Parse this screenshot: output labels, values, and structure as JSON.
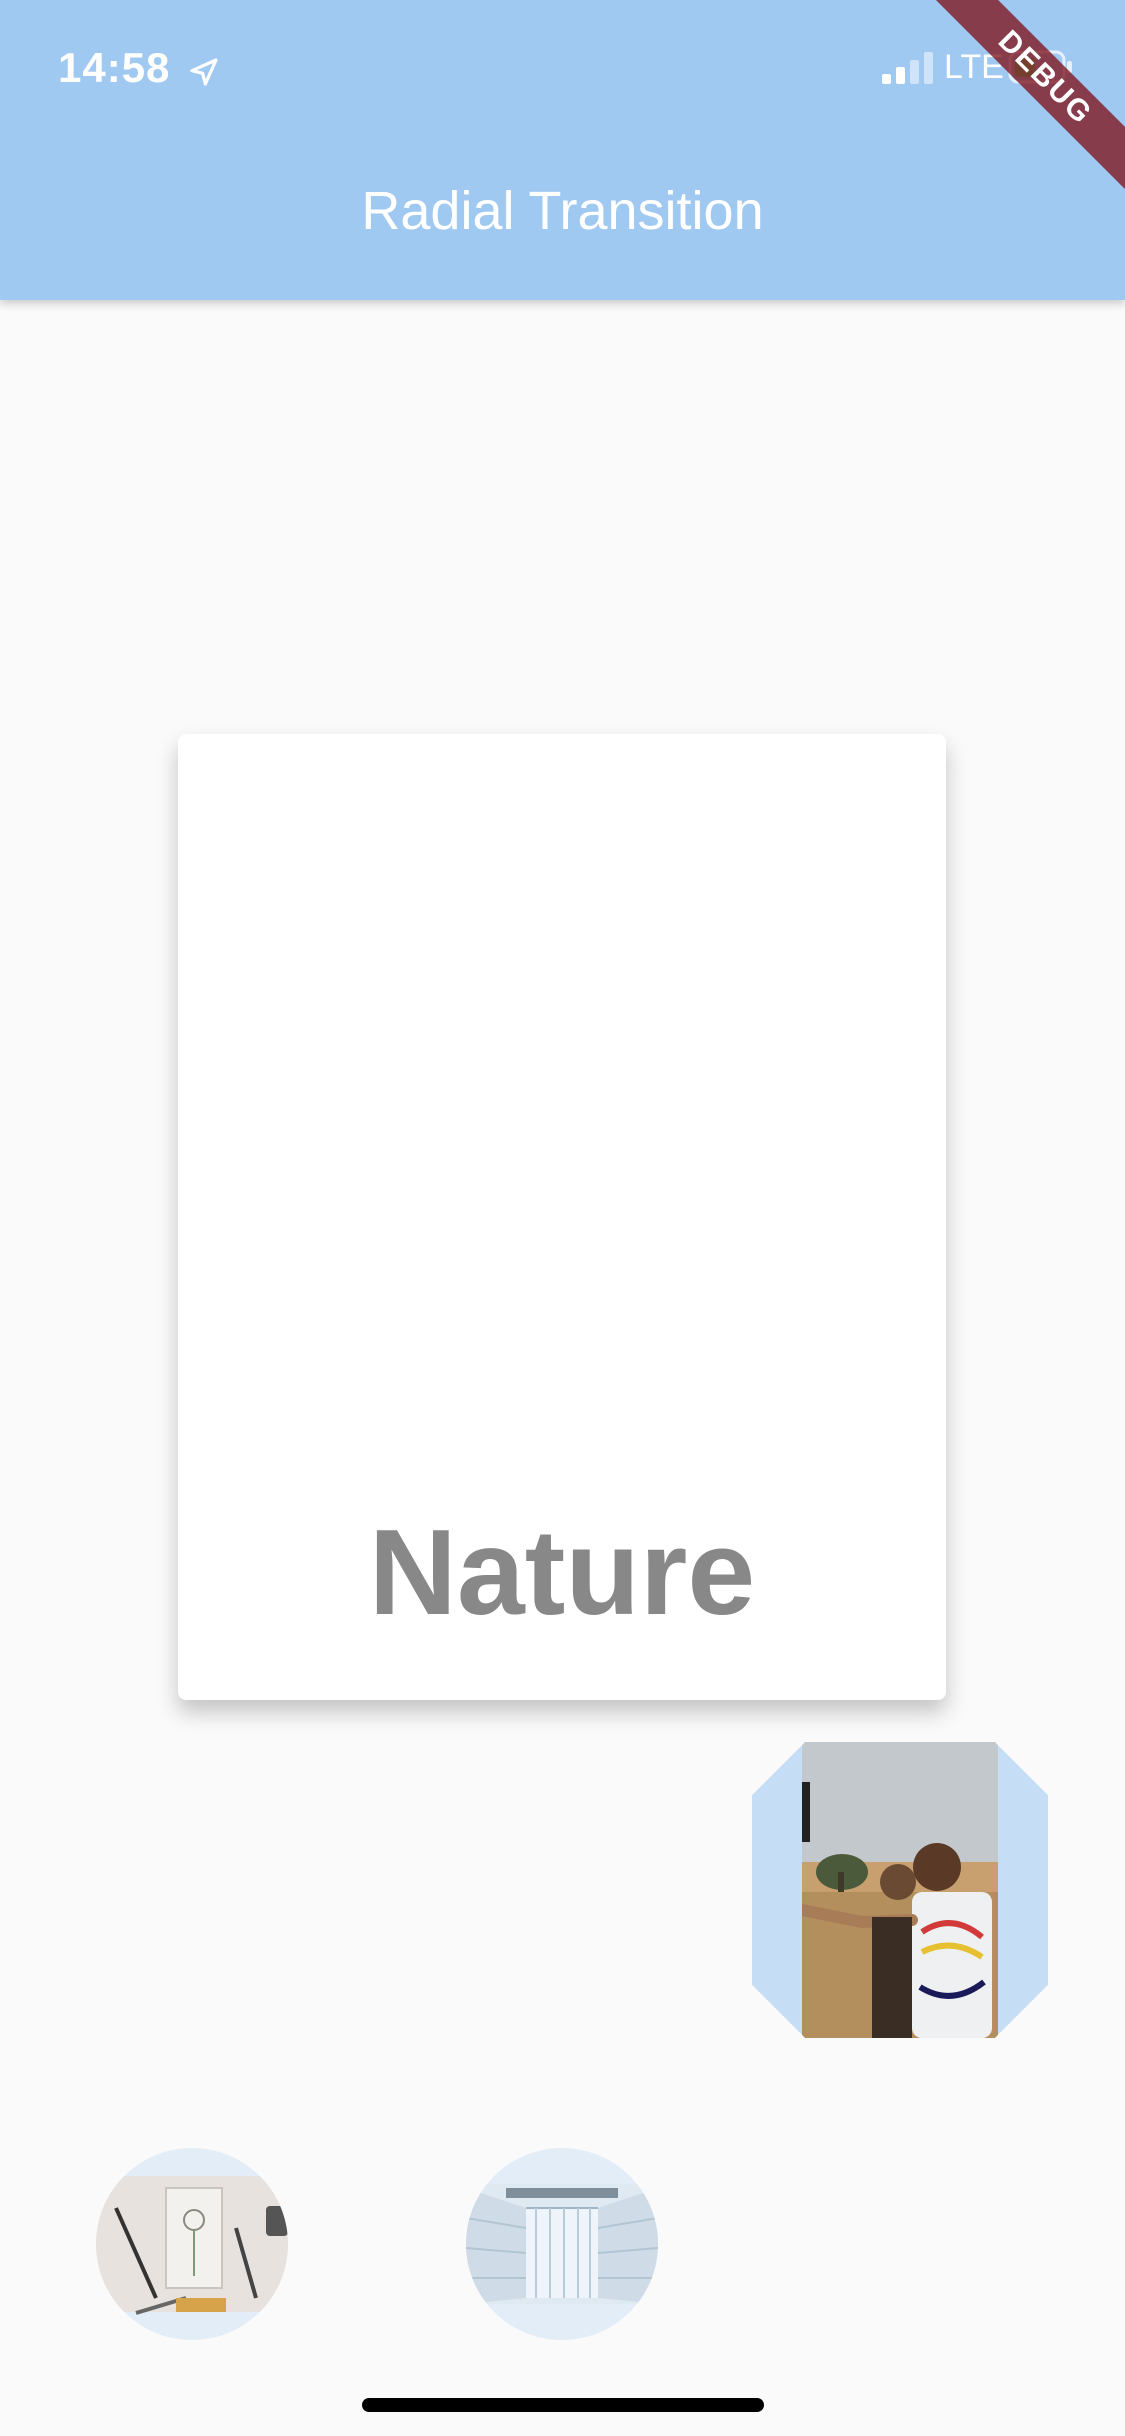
{
  "status_bar": {
    "time": "14:58",
    "network": "LTE",
    "icons": [
      "location-icon",
      "signal-icon",
      "battery-icon"
    ]
  },
  "app_bar": {
    "title": "Radial Transition",
    "background_color": "#a0c9f2",
    "debug_label": "DEBUG"
  },
  "card": {
    "label": "Nature",
    "label_color": "#888888"
  },
  "fab": {
    "image": "selfie-photo",
    "background_color": "#c6ddf6"
  },
  "thumbnails": [
    {
      "image": "art-supplies-photo"
    },
    {
      "image": "architecture-photo"
    }
  ]
}
